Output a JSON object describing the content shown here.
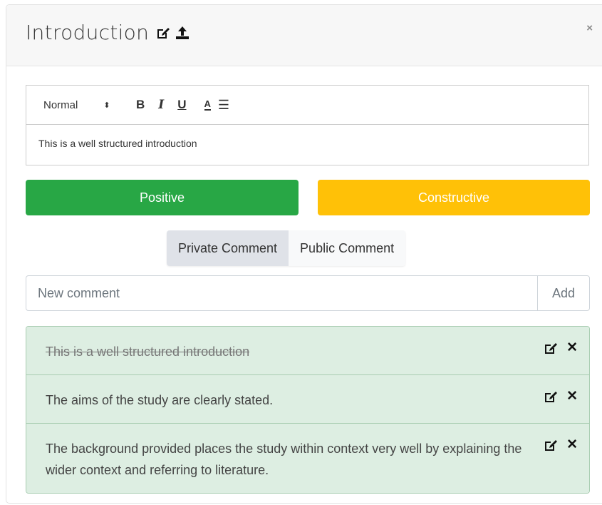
{
  "modal": {
    "title": "Introduction",
    "close_label": "×"
  },
  "editor": {
    "format_select": "Normal",
    "format_arrows": "⬍",
    "bold": "B",
    "italic": "I",
    "underline": "U",
    "color": "A",
    "list": "☰",
    "content": "This is a well structured introduction"
  },
  "feedback_buttons": {
    "positive": "Positive",
    "constructive": "Constructive"
  },
  "comment_type": {
    "private": "Private Comment",
    "public": "Public Comment",
    "selected": "Private Comment"
  },
  "new_comment": {
    "placeholder": "New comment",
    "value": "",
    "add_label": "Add"
  },
  "comments": [
    {
      "text": "This is a well structured introduction",
      "struck": true
    },
    {
      "text": "The aims of the study are clearly stated.",
      "struck": false
    },
    {
      "text": "The background provided places the study within context very well by explaining the wider context and referring to literature.",
      "struck": false
    }
  ],
  "colors": {
    "positive": "#28a745",
    "constructive": "#ffc107",
    "comment_bg": "#ddeee2",
    "comment_border": "#a9cdb2"
  },
  "icons": {
    "edit": "edit-icon",
    "upload": "upload-icon",
    "delete": "close-icon"
  }
}
